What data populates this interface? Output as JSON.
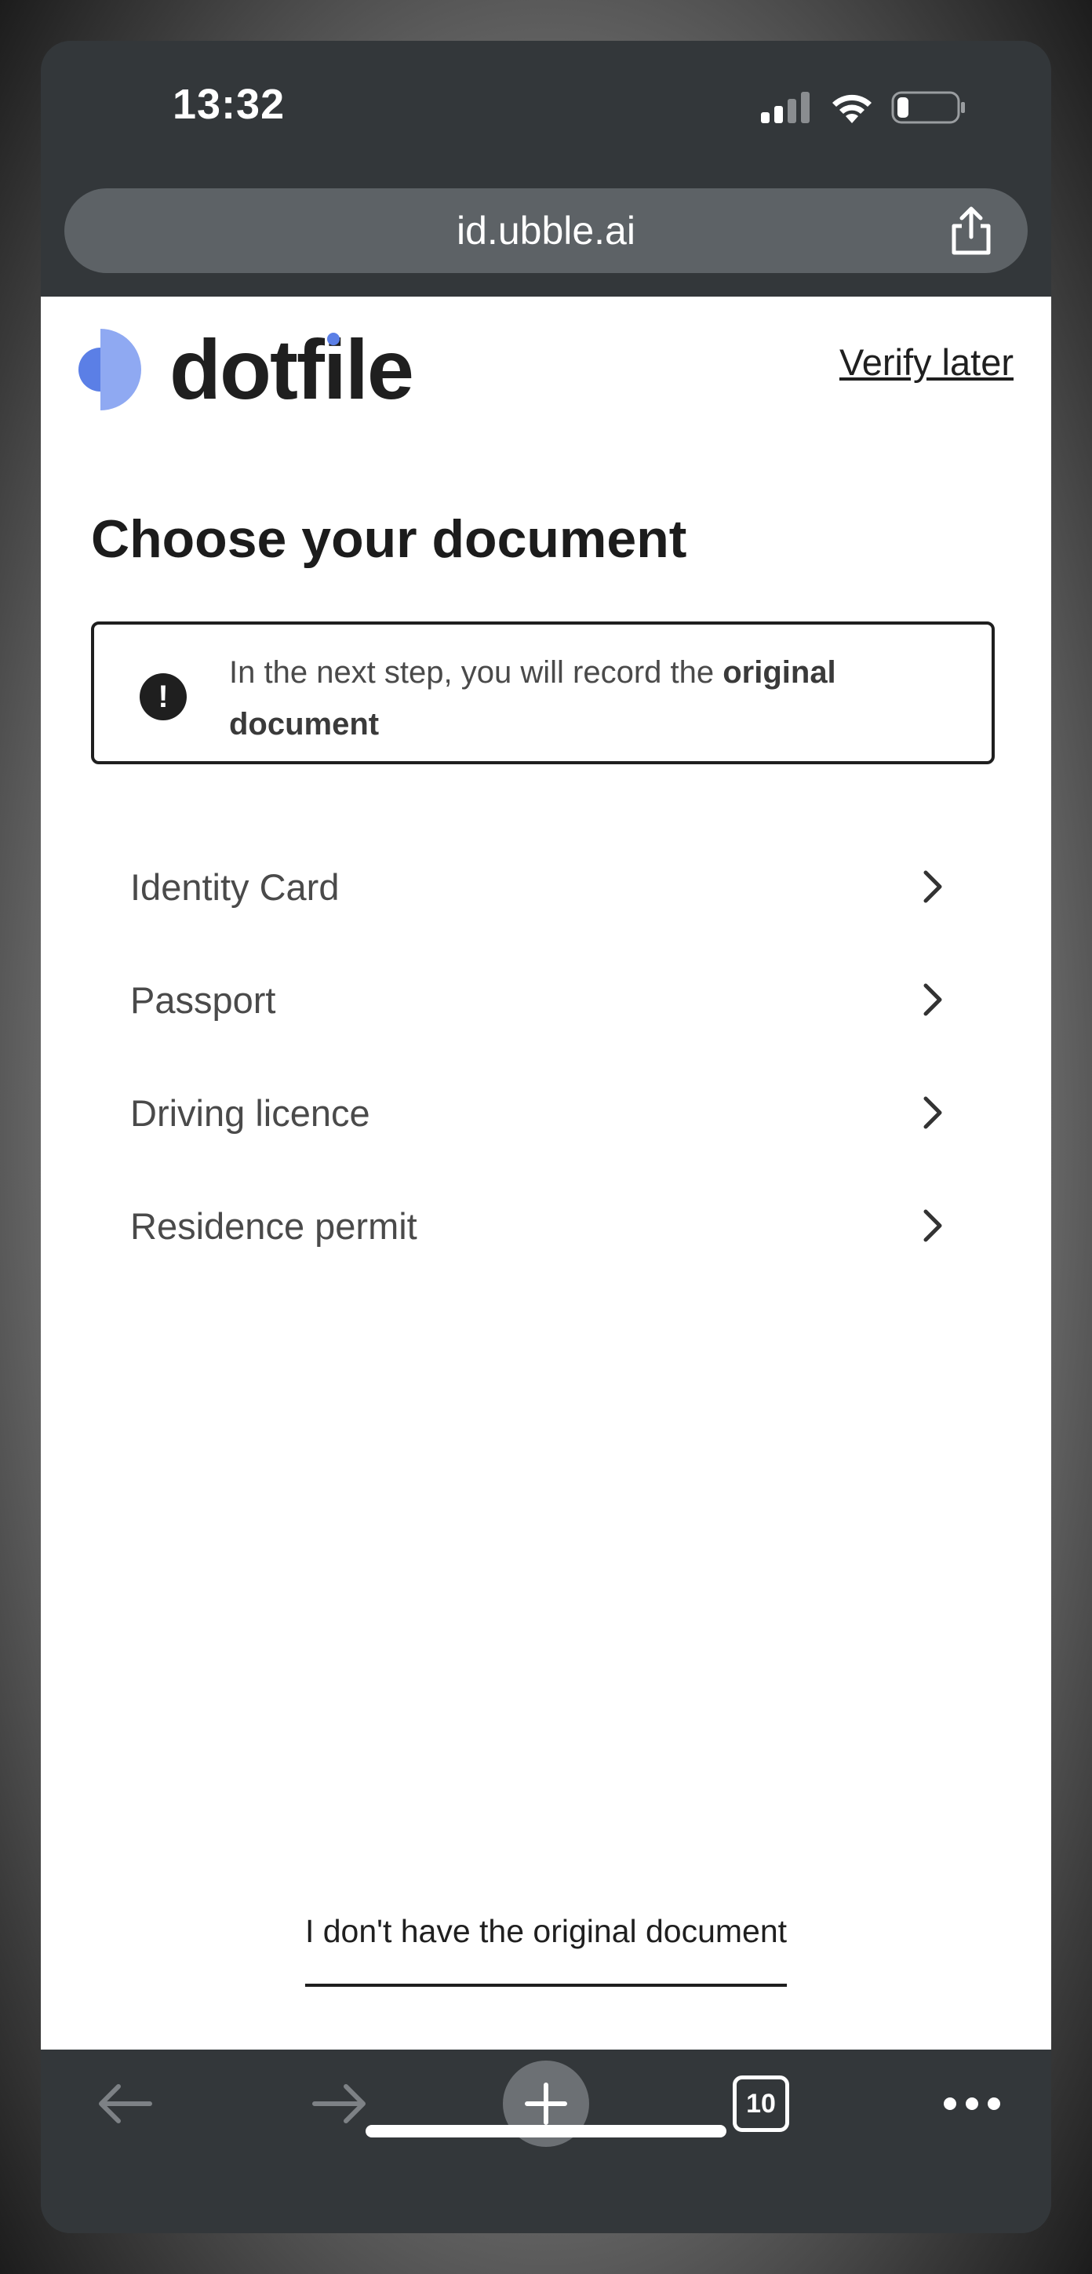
{
  "status_bar": {
    "time": "13:32"
  },
  "browser": {
    "url": "id.ubble.ai",
    "tab_count": "10"
  },
  "header": {
    "logo_text": "dotfile",
    "verify_later": "Verify later"
  },
  "main": {
    "title": "Choose your document",
    "notice": {
      "text_prefix": "In the next step, you will record the ",
      "text_bold": "original document"
    },
    "documents": [
      "Identity Card",
      "Passport",
      "Driving licence",
      "Residence permit"
    ],
    "no_original_link": "I don't have the original document"
  },
  "colors": {
    "accent": "#5b7fe6",
    "logo_light": "#8fa9f2",
    "chrome": "#33373a"
  }
}
